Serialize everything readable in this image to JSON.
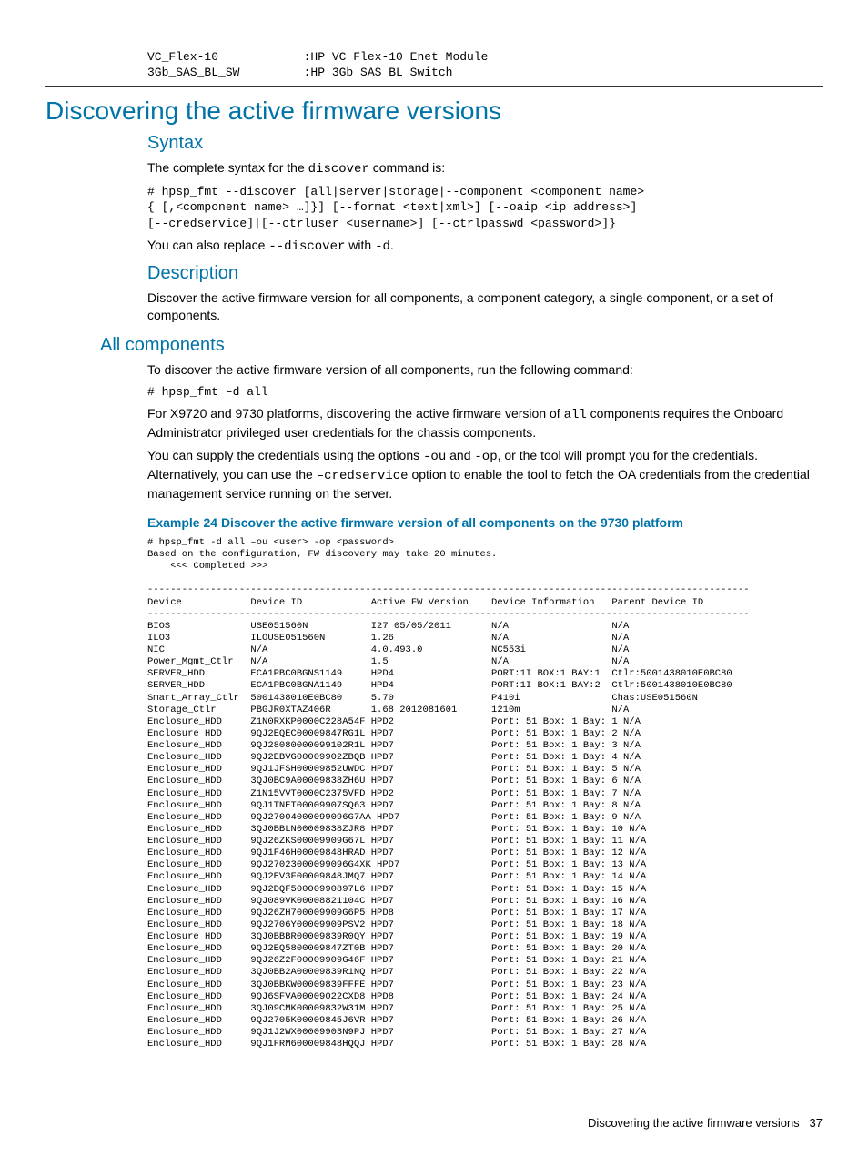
{
  "top_block": "VC_Flex-10            :HP VC Flex-10 Enet Module\n3Gb_SAS_BL_SW         :HP 3Gb SAS BL Switch",
  "h1": "Discovering the active firmware versions",
  "syntax": {
    "heading": "Syntax",
    "intro_pre": "The complete syntax for the ",
    "intro_code": "discover",
    "intro_post": " command is:",
    "code": "# hpsp_fmt --discover [all|server|storage|--component <component name>\n{ [,<component name> …]}] [--format <text|xml>] [--oaip <ip address>]\n[--credservice]|[--ctrluser <username>] [--ctrlpasswd <password>]}",
    "note_pre": "You can also replace ",
    "note_code1": "--discover",
    "note_mid": " with ",
    "note_code2": "-d",
    "note_post": "."
  },
  "description": {
    "heading": "Description",
    "text": "Discover the active firmware version for all components, a component category, a single component, or a set of components."
  },
  "allcomp": {
    "heading": "All components",
    "p1": "To discover the active firmware version of all components, run the following command:",
    "cmd": "# hpsp_fmt –d all",
    "p2_pre": "For X9720 and 9730 platforms, discovering the active firmware version of ",
    "p2_code": "all",
    "p2_post": " components requires the Onboard Administrator privileged user credentials for the chassis components.",
    "p3_pre": "You can supply the credentials using the options  ",
    "p3_c1": "-ou",
    "p3_mid1": " and ",
    "p3_c2": "-op",
    "p3_mid2": ", or the tool will prompt you for the credentials. Alternatively, you can use the ",
    "p3_c3": "–credservice",
    "p3_post": " option to enable the tool to fetch the OA credentials from the credential management service running on the server."
  },
  "example": {
    "title": "Example 24 Discover the active firmware version of all components on the 9730 platform",
    "output": "# hpsp_fmt -d all –ou <user> -op <password>\nBased on the configuration, FW discovery may take 20 minutes.\n    <<< Completed >>>\n\n---------------------------------------------------------------------------------------------------------\nDevice            Device ID            Active FW Version    Device Information   Parent Device ID\n---------------------------------------------------------------------------------------------------------\nBIOS              USE051560N           I27 05/05/2011       N/A                  N/A\nILO3              ILOUSE051560N        1.26                 N/A                  N/A\nNIC               N/A                  4.0.493.0            NC553i               N/A\nPower_Mgmt_Ctlr   N/A                  1.5                  N/A                  N/A\nSERVER_HDD        ECA1PBC0BGNS1149     HPD4                 PORT:1I BOX:1 BAY:1  Ctlr:5001438010E0BC80\nSERVER_HDD        ECA1PBC0BGNA1149     HPD4                 PORT:1I BOX:1 BAY:2  Ctlr:5001438010E0BC80\nSmart_Array_Ctlr  5001438010E0BC80     5.70                 P410i                Chas:USE051560N\nStorage_Ctlr      PBGJR0XTAZ406R       1.68 2012081601      1210m                N/A\nEnclosure_HDD     Z1N0RXKP0000C228A54F HPD2                 Port: 51 Box: 1 Bay: 1 N/A\nEnclosure_HDD     9QJ2EQEC00009847RG1L HPD7                 Port: 51 Box: 1 Bay: 2 N/A\nEnclosure_HDD     9QJ28080000099102R1L HPD7                 Port: 51 Box: 1 Bay: 3 N/A\nEnclosure_HDD     9QJ2EBVG00009902ZBQB HPD7                 Port: 51 Box: 1 Bay: 4 N/A\nEnclosure_HDD     9QJ1JFSH00009852UWDC HPD7                 Port: 51 Box: 1 Bay: 5 N/A\nEnclosure_HDD     3QJ0BC9A00009838ZH6U HPD7                 Port: 51 Box: 1 Bay: 6 N/A\nEnclosure_HDD     Z1N15VVT0000C2375VFD HPD2                 Port: 51 Box: 1 Bay: 7 N/A\nEnclosure_HDD     9QJ1TNET00009907SQ63 HPD7                 Port: 51 Box: 1 Bay: 8 N/A\nEnclosure_HDD     9QJ27004000099096G7AA HPD7                Port: 51 Box: 1 Bay: 9 N/A\nEnclosure_HDD     3QJ0BBLN00009838ZJR8 HPD7                 Port: 51 Box: 1 Bay: 10 N/A\nEnclosure_HDD     9QJ26ZKS00009909G67L HPD7                 Port: 51 Box: 1 Bay: 11 N/A\nEnclosure_HDD     9QJ1F46H00009848HRAD HPD7                 Port: 51 Box: 1 Bay: 12 N/A\nEnclosure_HDD     9QJ27023000099096G4XK HPD7                Port: 51 Box: 1 Bay: 13 N/A\nEnclosure_HDD     9QJ2EV3F00009848JMQ7 HPD7                 Port: 51 Box: 1 Bay: 14 N/A\nEnclosure_HDD     9QJ2DQF50000990897L6 HPD7                 Port: 51 Box: 1 Bay: 15 N/A\nEnclosure_HDD     9QJ089VK00008821104C HPD7                 Port: 51 Box: 1 Bay: 16 N/A\nEnclosure_HDD     9QJ26ZH700009909G6P5 HPD8                 Port: 51 Box: 1 Bay: 17 N/A\nEnclosure_HDD     9QJ2706Y00009909PSV2 HPD7                 Port: 51 Box: 1 Bay: 18 N/A\nEnclosure_HDD     3QJ0BBBR00009839R0QY HPD7                 Port: 51 Box: 1 Bay: 19 N/A\nEnclosure_HDD     9QJ2EQ5800009847ZT0B HPD7                 Port: 51 Box: 1 Bay: 20 N/A\nEnclosure_HDD     9QJ26Z2F00009909G46F HPD7                 Port: 51 Box: 1 Bay: 21 N/A\nEnclosure_HDD     3QJ0BB2A00009839R1NQ HPD7                 Port: 51 Box: 1 Bay: 22 N/A\nEnclosure_HDD     3QJ0BBKW00009839FFFE HPD7                 Port: 51 Box: 1 Bay: 23 N/A\nEnclosure_HDD     9QJ6SFVA00009022CXD8 HPD8                 Port: 51 Box: 1 Bay: 24 N/A\nEnclosure_HDD     3QJ09CMK00009832W31M HPD7                 Port: 51 Box: 1 Bay: 25 N/A\nEnclosure_HDD     9QJ2705K00009845J6VR HPD7                 Port: 51 Box: 1 Bay: 26 N/A\nEnclosure_HDD     9QJ1J2WX00009903N9PJ HPD7                 Port: 51 Box: 1 Bay: 27 N/A\nEnclosure_HDD     9QJ1FRM600009848HQQJ HPD7                 Port: 51 Box: 1 Bay: 28 N/A"
  },
  "footer": {
    "text": "Discovering the active firmware versions",
    "page": "37"
  }
}
